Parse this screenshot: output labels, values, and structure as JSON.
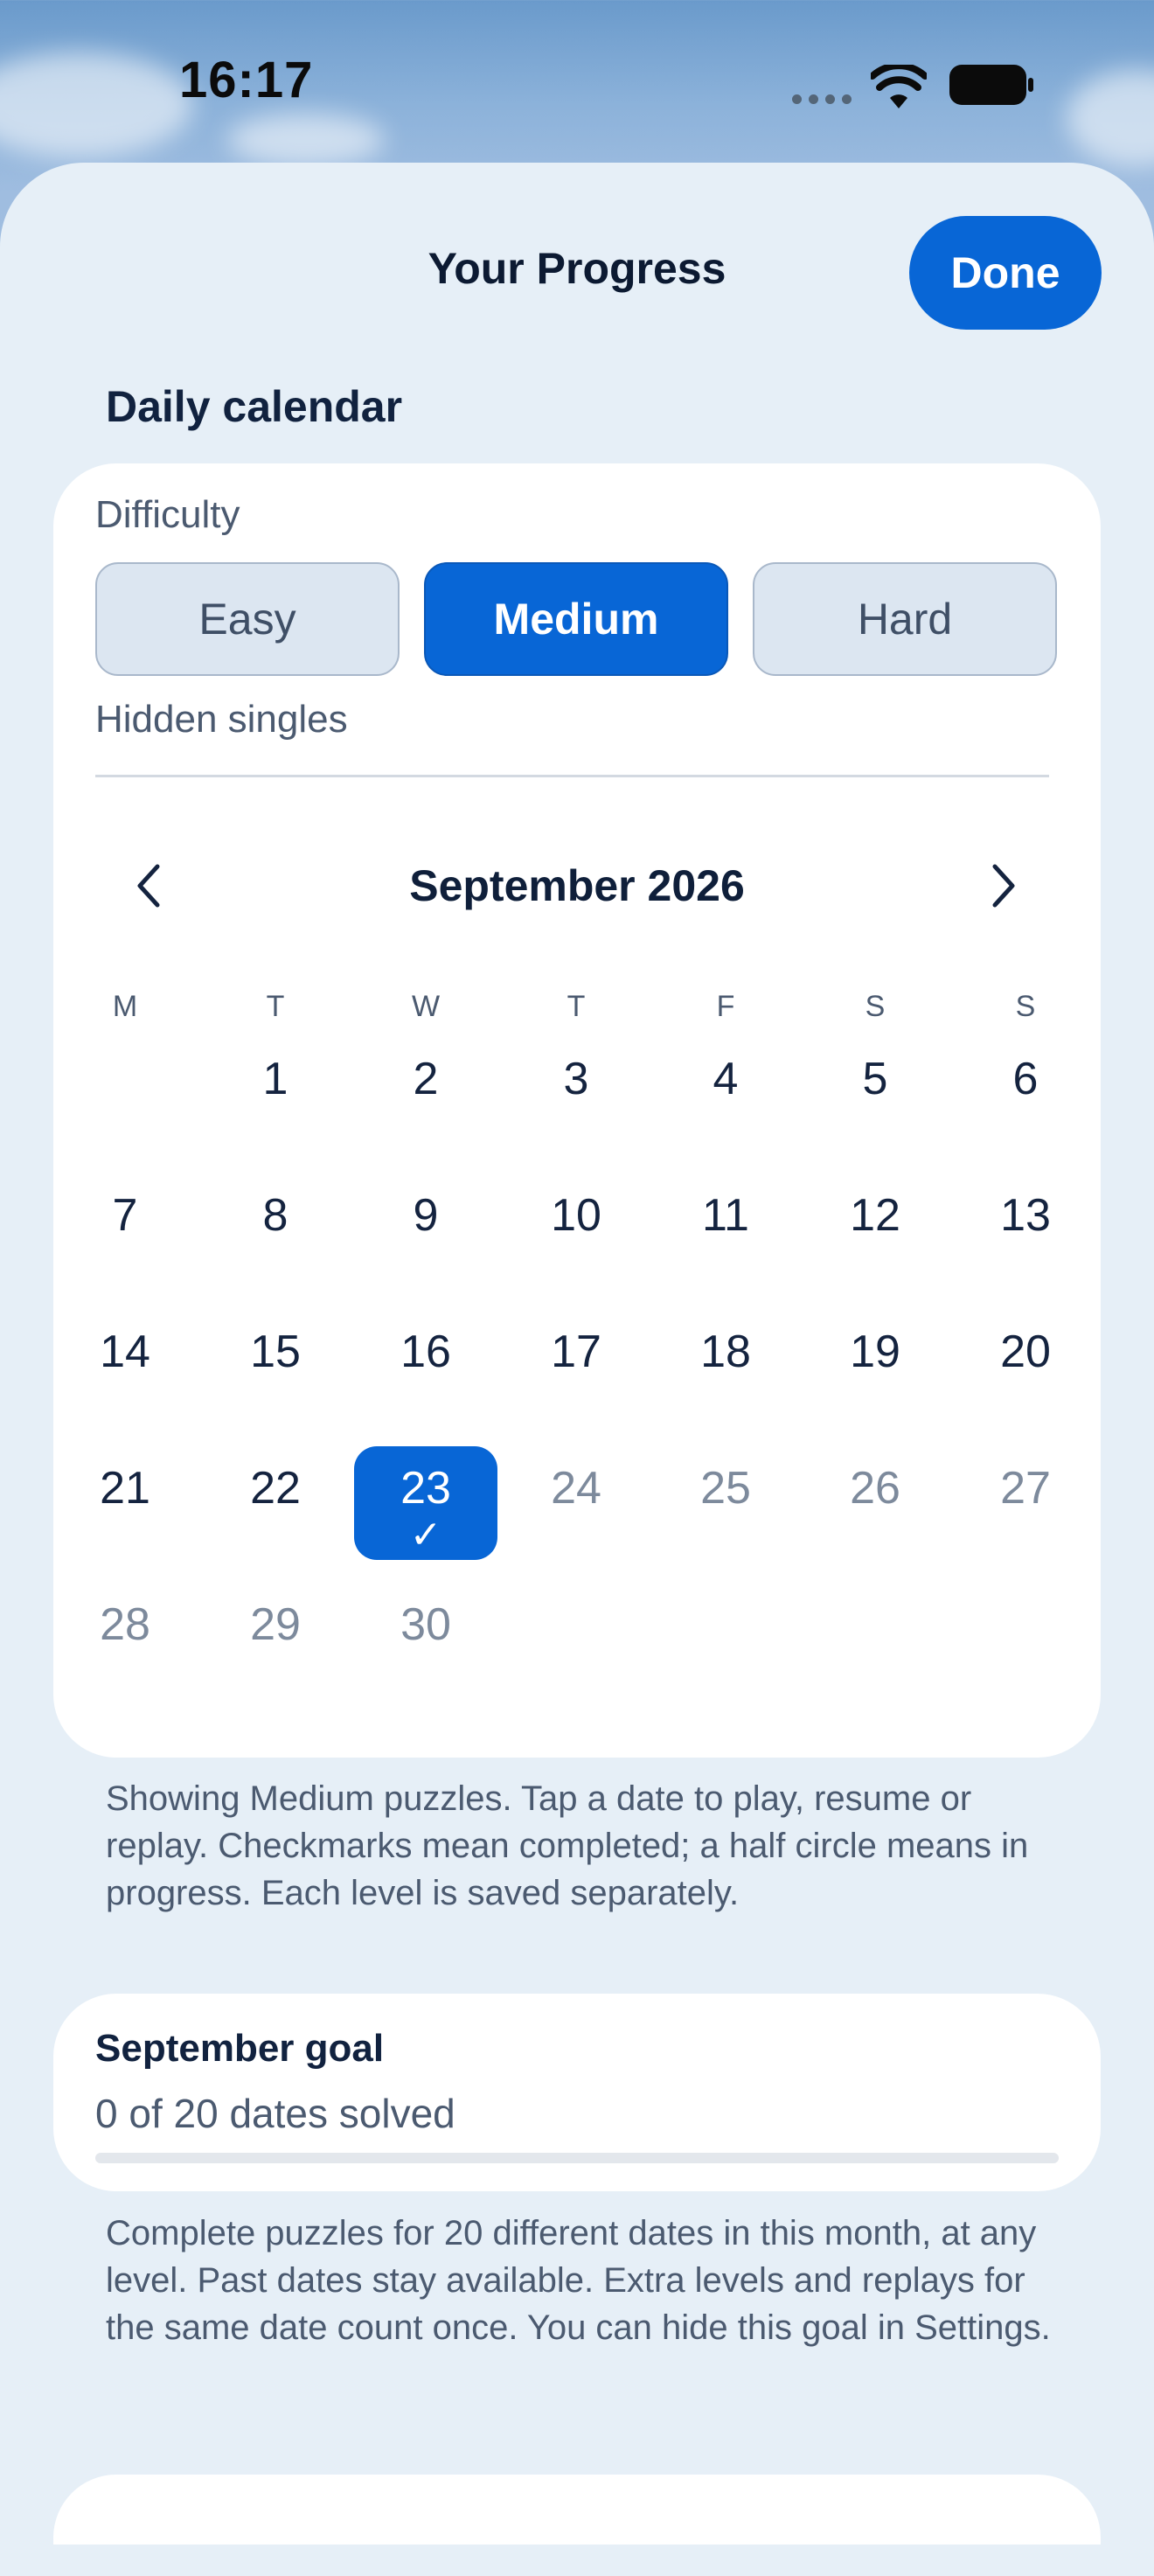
{
  "status_bar": {
    "time": "16:17",
    "icons": [
      "signal-dots-icon",
      "wifi-icon",
      "battery-icon"
    ]
  },
  "header": {
    "title": "Your Progress",
    "done_label": "Done"
  },
  "section": {
    "title": "Daily calendar"
  },
  "difficulty": {
    "label": "Difficulty",
    "options": [
      "Easy",
      "Medium",
      "Hard"
    ],
    "selected": "Medium",
    "hint": "Hidden singles"
  },
  "calendar": {
    "month_title": "September 2026",
    "prev_icon": "chevron-left-icon",
    "next_icon": "chevron-right-icon",
    "weekdays": [
      "M",
      "T",
      "W",
      "T",
      "F",
      "S",
      "S"
    ],
    "first_weekday_offset": 1,
    "days_in_month": 30,
    "selected_day": 23,
    "completed_days": [
      23
    ],
    "days": [
      "1",
      "2",
      "3",
      "4",
      "5",
      "6",
      "7",
      "8",
      "9",
      "10",
      "11",
      "12",
      "13",
      "14",
      "15",
      "16",
      "17",
      "18",
      "19",
      "20",
      "21",
      "22",
      "23",
      "24",
      "25",
      "26",
      "27",
      "28",
      "29",
      "30"
    ],
    "check_mark": "✓"
  },
  "calendar_note": "Showing Medium puzzles. Tap a date to play, resume or replay. Checkmarks mean completed; a half circle means in progress. Each level is saved separately.",
  "goal": {
    "title": "September goal",
    "count_text": "0 of 20 dates solved",
    "solved": 0,
    "target": 20
  },
  "goal_note": "Complete puzzles for 20 different dates in this month, at any level. Past dates stay available. Extra levels and replays for the same date count once. You can hide this goal in Settings.",
  "colors": {
    "accent": "#0866d6",
    "sheet": "#e6eff7",
    "card": "#ffffff",
    "muted_text": "#4b5a70"
  }
}
